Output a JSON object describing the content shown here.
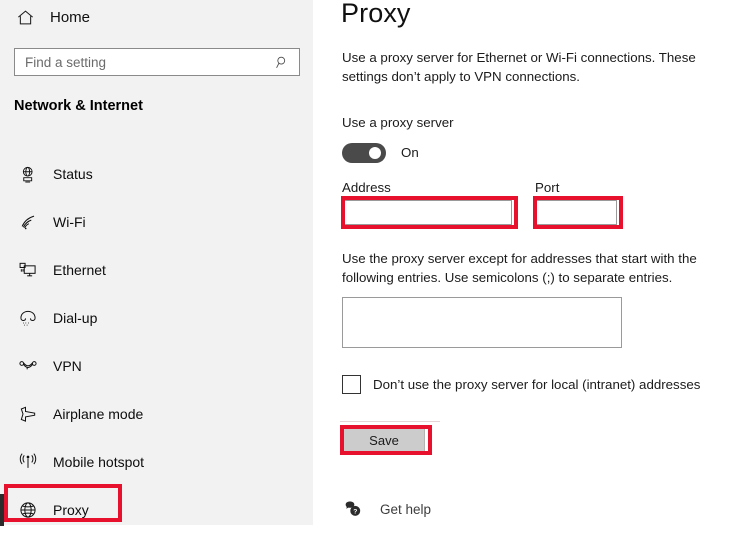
{
  "sidebar": {
    "home": {
      "label": "Home",
      "icon": "home-icon"
    },
    "search": {
      "value": "Find a setting",
      "placeholder": "Find a setting",
      "icon": "search-icon"
    },
    "section_title": "Network & Internet",
    "items": [
      {
        "label": "Status",
        "icon": "network-status-icon",
        "selected": false
      },
      {
        "label": "Wi-Fi",
        "icon": "wifi-icon",
        "selected": false
      },
      {
        "label": "Ethernet",
        "icon": "ethernet-icon",
        "selected": false
      },
      {
        "label": "Dial-up",
        "icon": "dialup-icon",
        "selected": false
      },
      {
        "label": "VPN",
        "icon": "vpn-icon",
        "selected": false
      },
      {
        "label": "Airplane mode",
        "icon": "airplane-icon",
        "selected": false
      },
      {
        "label": "Mobile hotspot",
        "icon": "hotspot-icon",
        "selected": false
      },
      {
        "label": "Proxy",
        "icon": "globe-icon",
        "selected": true
      }
    ]
  },
  "main": {
    "title": "Proxy",
    "description": "Use a proxy server for Ethernet or Wi-Fi connections. These settings don’t apply to VPN connections.",
    "use_proxy_label": "Use a proxy server",
    "toggle_state": "On",
    "address_label": "Address",
    "address_value": "",
    "port_label": "Port",
    "port_value": "",
    "exceptions_description": "Use the proxy server except for addresses that start with the following entries. Use semicolons (;) to separate entries.",
    "exceptions_value": "",
    "checkbox_label": "Don’t use the proxy server for local (intranet) addresses",
    "checkbox_checked": false,
    "save_label": "Save",
    "get_help_label": "Get help"
  },
  "annotations": {
    "color": "#e8112d",
    "boxes": [
      "proxy-nav-item",
      "address-field",
      "port-field",
      "save-button"
    ]
  }
}
